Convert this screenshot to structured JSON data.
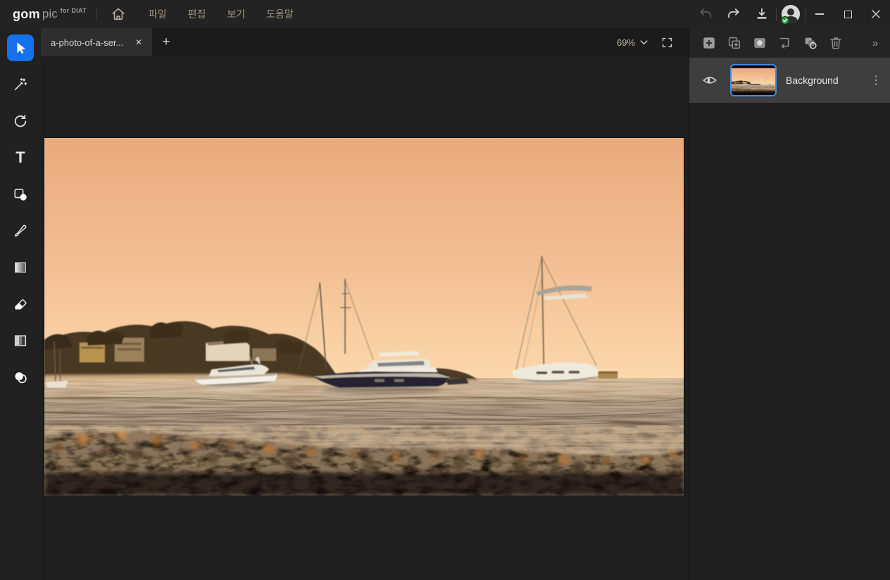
{
  "app": {
    "brand": {
      "gom": "gom",
      "pic": "pic",
      "suffix": "for DIAT"
    },
    "menus": [
      {
        "label": "파일"
      },
      {
        "label": "편집"
      },
      {
        "label": "보기"
      },
      {
        "label": "도움말"
      }
    ]
  },
  "tabbar": {
    "active_tab": {
      "label": "a-photo-of-a-ser...",
      "close_glyph": "✕"
    },
    "new_tab_glyph": "+",
    "zoom": {
      "value": "69%"
    }
  },
  "toolrail": {
    "text_tool_glyph": "T"
  },
  "layers_panel": {
    "collapse_glyph": "»",
    "items": [
      {
        "name": "Background",
        "menu_glyph": "⋮",
        "visible": true,
        "selected": true
      }
    ]
  },
  "colors": {
    "accent_blue": "#1672ec",
    "thumbnail_border": "#3f8cea",
    "topbar_bg": "#232323",
    "panel_bg": "#1f1f1f",
    "layer_row_bg": "#3e3e3e",
    "sky_top": "#e9aa7c",
    "sky_horizon": "#fbd8ac",
    "water_mid": "#6e5c4a",
    "pebble_dark": "#191209",
    "status_badge_green": "#1fa83c"
  }
}
